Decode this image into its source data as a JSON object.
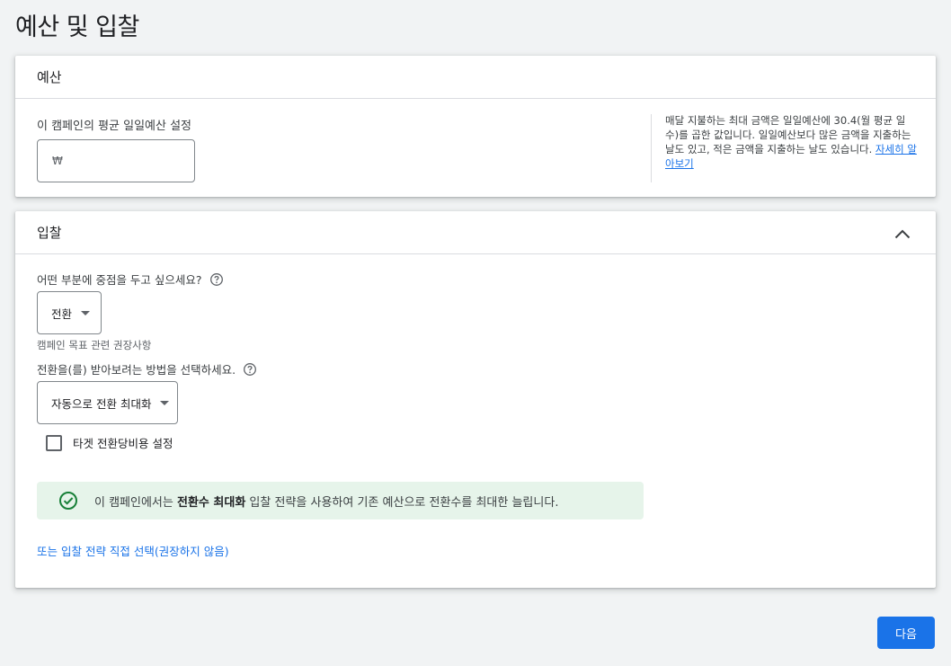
{
  "page": {
    "title": "예산 및 입찰"
  },
  "budget": {
    "header": "예산",
    "label": "이 캠페인의 평균 일일예산 설정",
    "currency": "₩",
    "value": "",
    "help_text": "매달 지불하는 최대 금액은 일일예산에 30.4(월 평균 일수)를 곱한 값입니다. 일일예산보다 많은 금액을 지출하는 날도 있고, 적은 금액을 지출하는 날도 있습니다. ",
    "help_link": "자세히 알아보기"
  },
  "bidding": {
    "header": "입찰",
    "focus_question": "어떤 부분에 중점을 두고 싶으세요?",
    "focus_value": "전환",
    "focus_hint": "캠페인 목표 관련 권장사항",
    "method_question": "전환을(를) 받아보려는 방법을 선택하세요.",
    "method_value": "자동으로 전환 최대화",
    "target_cpa_label": "타겟 전환당비용 설정",
    "banner_prefix": "이 캠페인에서는 ",
    "banner_strategy": "전환수 최대화",
    "banner_suffix": " 입찰 전략을 사용하여 기존 예산으로 전환수를 최대한 늘립니다.",
    "manual_link": "또는 입찰 전략 직접 선택(권장하지 않음)"
  },
  "footer": {
    "next_label": "다음"
  },
  "colors": {
    "accent": "#1a73e8",
    "success": "#188038",
    "banner_bg": "#e6f4ea"
  },
  "icons": [
    "chevron-up-icon",
    "help-icon",
    "dropdown-caret-icon",
    "check-circle-icon"
  ]
}
